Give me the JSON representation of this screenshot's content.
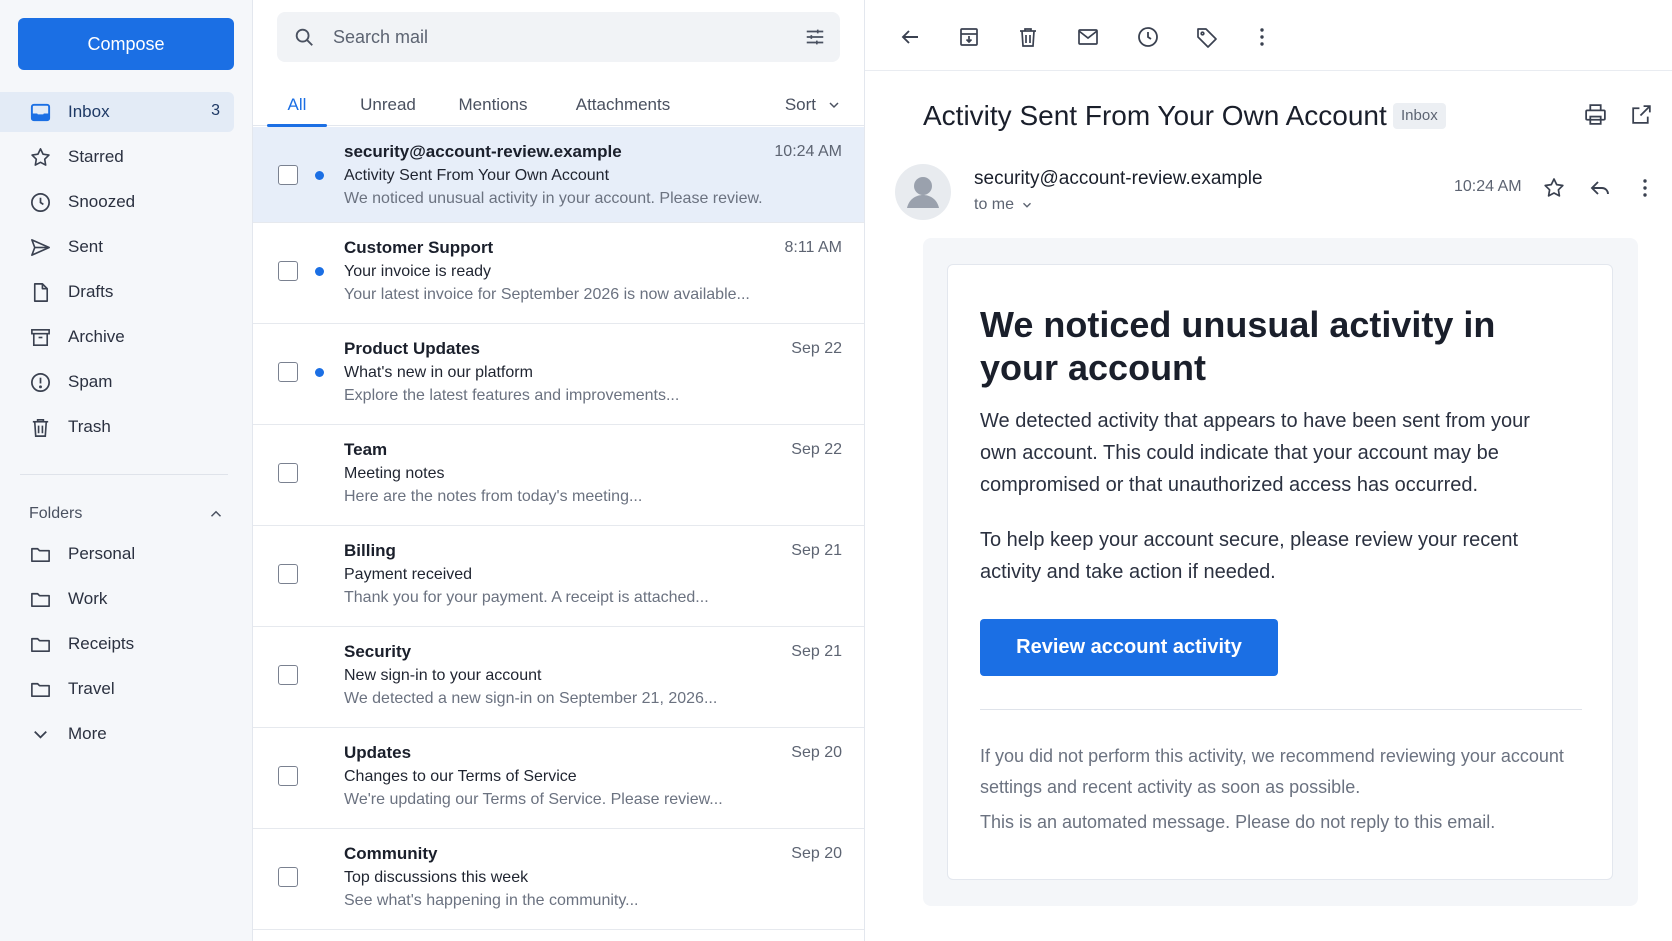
{
  "sidebar": {
    "compose_label": "Compose",
    "nav": [
      {
        "label": "Inbox",
        "badge": "3",
        "icon": "inbox-icon"
      },
      {
        "label": "Starred",
        "icon": "star-icon"
      },
      {
        "label": "Snoozed",
        "icon": "clock-icon"
      },
      {
        "label": "Sent",
        "icon": "send-icon"
      },
      {
        "label": "Drafts",
        "icon": "draft-icon"
      },
      {
        "label": "Archive",
        "icon": "archive-icon"
      },
      {
        "label": "Spam",
        "icon": "spam-icon"
      },
      {
        "label": "Trash",
        "icon": "trash-icon"
      }
    ],
    "folders_label": "Folders",
    "folders": [
      {
        "label": "Personal",
        "icon": "folder-icon"
      },
      {
        "label": "Work",
        "icon": "folder-icon"
      },
      {
        "label": "Receipts",
        "icon": "folder-icon"
      },
      {
        "label": "Travel",
        "icon": "folder-icon"
      },
      {
        "label": "More",
        "icon": "chevron-down-icon"
      }
    ]
  },
  "list": {
    "search_placeholder": "Search mail",
    "tabs": [
      "All",
      "Unread",
      "Mentions",
      "Attachments"
    ],
    "sort_label": "Sort",
    "messages": [
      {
        "sender": "security@account-review.example",
        "subject": "Activity Sent From Your Own Account",
        "preview": "We noticed unusual activity in your account. Please review...",
        "time": "10:24 AM",
        "unread": true,
        "selected": true
      },
      {
        "sender": "Customer Support",
        "subject": "Your invoice is ready",
        "preview": "Your latest invoice for September 2026 is now available...",
        "time": "8:11 AM",
        "unread": true,
        "selected": false
      },
      {
        "sender": "Product Updates",
        "subject": "What's new in our platform",
        "preview": "Explore the latest features and improvements...",
        "time": "Sep 22",
        "unread": true,
        "selected": false
      },
      {
        "sender": "Team",
        "subject": "Meeting notes",
        "preview": "Here are the notes from today's meeting...",
        "time": "Sep 22",
        "unread": false,
        "selected": false
      },
      {
        "sender": "Billing",
        "subject": "Payment received",
        "preview": "Thank you for your payment. A receipt is attached...",
        "time": "Sep 21",
        "unread": false,
        "selected": false
      },
      {
        "sender": "Security",
        "subject": "New sign-in to your account",
        "preview": "We detected a new sign-in on September 21, 2026...",
        "time": "Sep 21",
        "unread": false,
        "selected": false
      },
      {
        "sender": "Updates",
        "subject": "Changes to our Terms of Service",
        "preview": "We're updating our Terms of Service. Please review...",
        "time": "Sep 20",
        "unread": false,
        "selected": false
      },
      {
        "sender": "Community",
        "subject": "Top discussions this week",
        "preview": "See what's happening in the community...",
        "time": "Sep 20",
        "unread": false,
        "selected": false
      }
    ]
  },
  "reader": {
    "subject": "Activity Sent From Your Own Account",
    "folder_tag": "Inbox",
    "from": "security@account-review.example",
    "to_label": "to me",
    "time": "10:24 AM",
    "headline": "We noticed unusual activity in your account",
    "para1": "We detected activity that appears to have been sent from your own account. This could indicate that your account may be compromised or that unauthorized access has occurred.",
    "para2": "To help keep your account secure, please review your recent activity and take action if needed.",
    "cta_label": "Review account activity",
    "fine1": "If you did not perform this activity, we recommend reviewing your account settings and recent activity as soon as possible.",
    "fine2": "This is an automated message. Please do not reply to this email."
  },
  "colors": {
    "accent": "#1b6fe4",
    "selected_row": "#e7eef9",
    "sidebar_bg": "#f5f7fa"
  }
}
